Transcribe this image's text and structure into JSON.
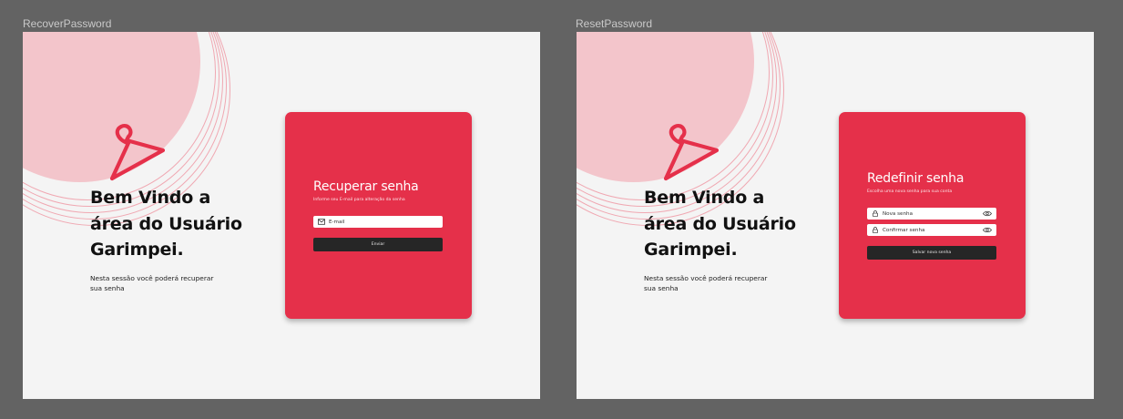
{
  "screens": [
    {
      "frame_label": "RecoverPassword",
      "welcome": [
        "Bem Vindo a",
        "área do Usuário",
        "Garimpei."
      ],
      "subtitle": "Nesta sessão você poderá recuperar sua senha",
      "card": {
        "title": "Recuperar senha",
        "subtitle": "Informe seu E-mail para alteração da senha",
        "email_placeholder": "E-mail",
        "email_icon": "mail-icon",
        "button": "Enviar"
      }
    },
    {
      "frame_label": "ResetPassword",
      "welcome": [
        "Bem Vindo a",
        "área do Usuário",
        "Garimpei."
      ],
      "subtitle": "Nesta sessão você poderá recuperar sua senha",
      "card": {
        "title": "Redefinir senha",
        "subtitle": "Escolha uma nova senha para sua conta",
        "new_password_placeholder": "Nova senha",
        "confirm_password_placeholder": "Confirmar senha",
        "field_icon": "lock-icon",
        "toggle_icon": "eye-icon",
        "button": "Salvar nova senha"
      }
    }
  ],
  "colors": {
    "canvas": "#636363",
    "frame_background": "#f4f4f4",
    "accent_circle": "#f3c5cb",
    "card": "#e5304a",
    "hanger": "#e5304a",
    "button": "#262626"
  }
}
